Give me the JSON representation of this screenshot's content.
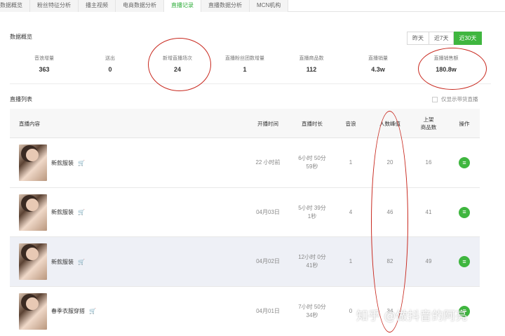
{
  "tabs": [
    {
      "label": "数据概览"
    },
    {
      "label": "粉丝特征分析"
    },
    {
      "label": "播主视频"
    },
    {
      "label": "电商数据分析"
    },
    {
      "label": "直播记录"
    },
    {
      "label": "直播数据分析"
    },
    {
      "label": "MCN机构"
    }
  ],
  "active_tab": "直播记录",
  "overview": {
    "title": "数据概览",
    "ranges": [
      "昨天",
      "近7天",
      "近30天"
    ],
    "active_range": "近30天",
    "stats": [
      {
        "label": "音浪增量",
        "value": "363"
      },
      {
        "label": "送出",
        "value": "0"
      },
      {
        "label": "新增直播场次",
        "value": "24"
      },
      {
        "label": "直播粉丝团数增量",
        "value": "1"
      },
      {
        "label": "直播商品数",
        "value": "112"
      },
      {
        "label": "直播销量",
        "value": "4.3w"
      },
      {
        "label": "直播销售额",
        "value": "180.8w"
      }
    ]
  },
  "list": {
    "title": "直播列表",
    "only_store_label": "仅显示带货直播",
    "columns": {
      "content": "直播内容",
      "start_time": "开播时间",
      "duration": "直播时长",
      "sound_waves": "音浪",
      "peak_viewers": "人数峰值",
      "products_line1": "上架",
      "products_line2": "商品数",
      "action": "操作"
    },
    "rows": [
      {
        "title": "新款服装",
        "start": "22 小时前",
        "dur1": "6小时 50分",
        "dur2": "59秒",
        "waves": "1",
        "peak": "20",
        "products": "16"
      },
      {
        "title": "新款服装",
        "start": "04月03日",
        "dur1": "5小时 39分",
        "dur2": "1秒",
        "waves": "4",
        "peak": "46",
        "products": "41"
      },
      {
        "title": "新款服装",
        "start": "04月02日",
        "dur1": "12小时 0分",
        "dur2": "41秒",
        "waves": "1",
        "peak": "82",
        "products": "49"
      },
      {
        "title": "春季衣服穿搭",
        "start": "04月01日",
        "dur1": "7小时 50分",
        "dur2": "34秒",
        "waves": "0",
        "peak": "34",
        "products": ""
      }
    ]
  },
  "icons": {
    "cart": "shopping-cart-icon",
    "detail": "list-detail-icon"
  },
  "colors": {
    "accent": "#3fb63f",
    "annotation": "#c8281e",
    "cart": "#e4393c"
  },
  "watermark": "知乎 @做抖音的阿亮"
}
